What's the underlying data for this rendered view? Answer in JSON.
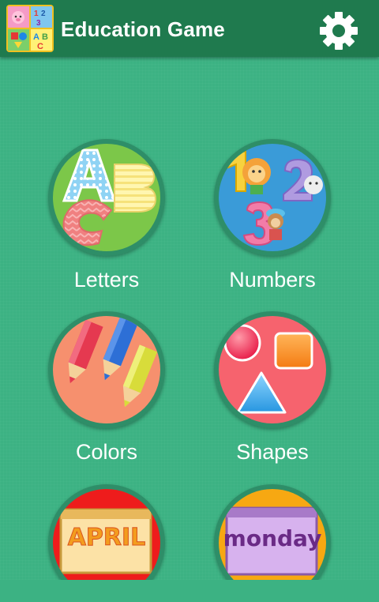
{
  "app_bar": {
    "title": "Education Game",
    "app_icon": "education-game-app-icon",
    "settings_icon": "gear-icon",
    "background_color": "#1f7a4e"
  },
  "background_color": "#3cb283",
  "categories": [
    {
      "label": "Letters",
      "icon": "letters-abc-icon"
    },
    {
      "label": "Numbers",
      "icon": "numbers-123-icon"
    },
    {
      "label": "Colors",
      "icon": "colored-pencils-icon"
    },
    {
      "label": "Shapes",
      "icon": "shapes-icon"
    },
    {
      "label": "",
      "icon": "months-calendar-icon",
      "card_text": "APRIL"
    },
    {
      "label": "",
      "icon": "days-calendar-icon",
      "card_text": "monday"
    }
  ]
}
